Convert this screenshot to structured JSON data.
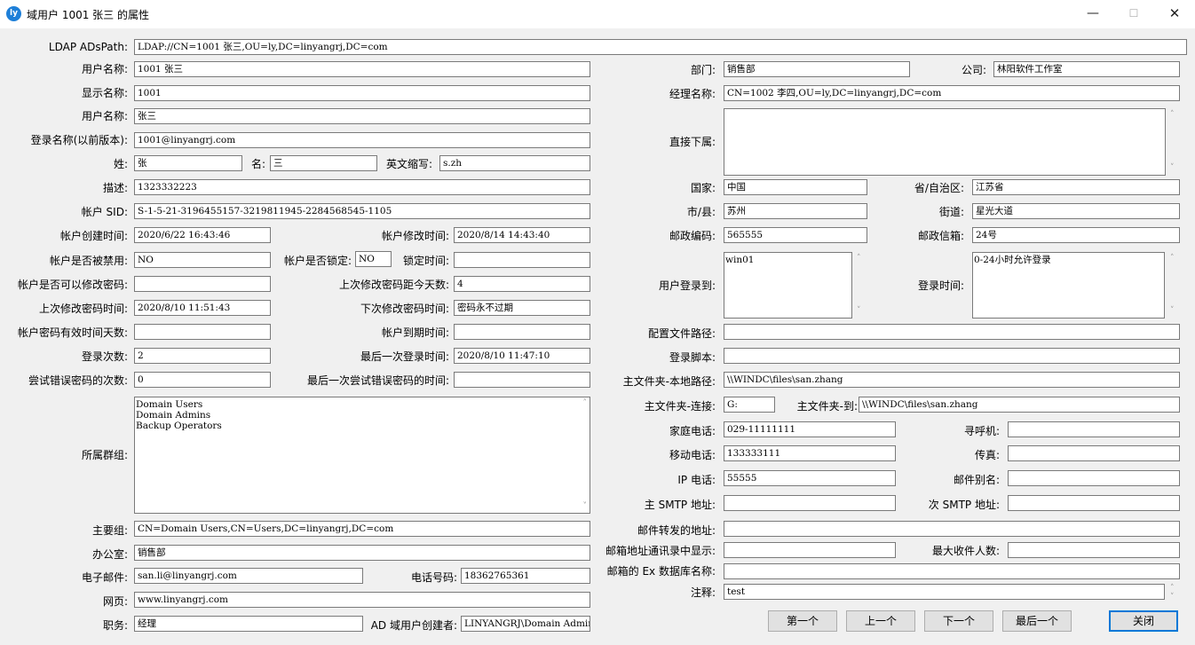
{
  "window": {
    "title": "域用户 1001 张三 的属性",
    "minimize": "—",
    "maximize": "☐",
    "close": "✕"
  },
  "icons": {
    "app": "app-logo-icon",
    "scroll_up": "˄",
    "scroll_down": "˅"
  },
  "ldap": {
    "label": "LDAP ADsPath:",
    "value": "LDAP://CN=1001 张三,OU=ly,DC=linyangrj,DC=com"
  },
  "left": {
    "username": {
      "label": "用户名称:",
      "value": "1001 张三"
    },
    "display_name": {
      "label": "显示名称:",
      "value": "1001"
    },
    "username2": {
      "label": "用户名称:",
      "value": "张三"
    },
    "login_name": {
      "label": "登录名称(以前版本):",
      "value": "1001@linyangrj.com"
    },
    "surname": {
      "label": "姓:",
      "value": "张"
    },
    "given_name": {
      "label": "名:",
      "value": "三"
    },
    "initials": {
      "label": "英文缩写:",
      "value": "s.zh"
    },
    "description": {
      "label": "描述:",
      "value": "1323332223"
    },
    "sid": {
      "label": "帐户 SID:",
      "value": "S-1-5-21-3196455157-3219811945-2284568545-1105"
    },
    "created": {
      "label": "帐户创建时间:",
      "value": "2020/6/22 16:43:46"
    },
    "modified": {
      "label": "帐户修改时间:",
      "value": "2020/8/14 14:43:40"
    },
    "disabled": {
      "label": "帐户是否被禁用:",
      "value": "NO"
    },
    "locked": {
      "label": "帐户是否锁定:",
      "value": "NO"
    },
    "lock_time": {
      "label": "锁定时间:",
      "value": ""
    },
    "can_change_pwd": {
      "label": "帐户是否可以修改密码:",
      "value": ""
    },
    "days_since_pwd": {
      "label": "上次修改密码距今天数:",
      "value": "4"
    },
    "last_pwd_change": {
      "label": "上次修改密码时间:",
      "value": "2020/8/10 11:51:43"
    },
    "next_pwd_change": {
      "label": "下次修改密码时间:",
      "value": "密码永不过期"
    },
    "pwd_valid_days": {
      "label": "帐户密码有效时间天数:",
      "value": ""
    },
    "expiry": {
      "label": "帐户到期时间:",
      "value": ""
    },
    "logon_count": {
      "label": "登录次数:",
      "value": "2"
    },
    "last_logon": {
      "label": "最后一次登录时间:",
      "value": "2020/8/10 11:47:10"
    },
    "bad_pwd_count": {
      "label": "尝试错误密码的次数:",
      "value": "0"
    },
    "last_bad_pwd": {
      "label": "最后一次尝试错误密码的时间:",
      "value": ""
    },
    "groups": {
      "label": "所属群组:",
      "items": [
        "Domain Users",
        "Domain Admins",
        "Backup Operators"
      ]
    },
    "primary_group": {
      "label": "主要组:",
      "value": "CN=Domain Users,CN=Users,DC=linyangrj,DC=com"
    },
    "office": {
      "label": "办公室:",
      "value": "销售部"
    },
    "email": {
      "label": "电子邮件:",
      "value": "san.li@linyangrj.com"
    },
    "phone": {
      "label": "电话号码:",
      "value": "18362765361"
    },
    "webpage": {
      "label": "网页:",
      "value": "www.linyangrj.com"
    },
    "title": {
      "label": "职务:",
      "value": "经理"
    },
    "creator": {
      "label": "AD 域用户创建者:",
      "value": "LINYANGRJ\\Domain Admins"
    }
  },
  "right": {
    "department": {
      "label": "部门:",
      "value": "销售部"
    },
    "company": {
      "label": "公司:",
      "value": "林阳软件工作室"
    },
    "manager": {
      "label": "经理名称:",
      "value": "CN=1002 李四,OU=ly,DC=linyangrj,DC=com"
    },
    "direct_reports": {
      "label": "直接下属:",
      "value": ""
    },
    "country": {
      "label": "国家:",
      "value": "中国"
    },
    "province": {
      "label": "省/自治区:",
      "value": "江苏省"
    },
    "city": {
      "label": "市/县:",
      "value": "苏州"
    },
    "street": {
      "label": "街道:",
      "value": "星光大道"
    },
    "postal_code": {
      "label": "邮政编码:",
      "value": "565555"
    },
    "po_box": {
      "label": "邮政信箱:",
      "value": "24号"
    },
    "logon_to": {
      "label": "用户登录到:",
      "value": "win01"
    },
    "logon_hours": {
      "label": "登录时间:",
      "value": "0-24小时允许登录"
    },
    "profile_path": {
      "label": "配置文件路径:",
      "value": ""
    },
    "logon_script": {
      "label": "登录脚本:",
      "value": ""
    },
    "home_local": {
      "label": "主文件夹-本地路径:",
      "value": "\\\\WINDC\\files\\san.zhang"
    },
    "home_drive": {
      "label": "主文件夹-连接:",
      "value": "G:"
    },
    "home_to": {
      "label": "主文件夹-到:",
      "value": "\\\\WINDC\\files\\san.zhang"
    },
    "home_phone": {
      "label": "家庭电话:",
      "value": "029-11111111"
    },
    "pager": {
      "label": "寻呼机:",
      "value": ""
    },
    "mobile": {
      "label": "移动电话:",
      "value": "133333111"
    },
    "fax": {
      "label": "传真:",
      "value": ""
    },
    "ip_phone": {
      "label": "IP 电话:",
      "value": "55555"
    },
    "mail_alias": {
      "label": "邮件别名:",
      "value": ""
    },
    "smtp_primary": {
      "label": "主 SMTP 地址:",
      "value": ""
    },
    "smtp_secondary": {
      "label": "次 SMTP 地址:",
      "value": ""
    },
    "forward": {
      "label": "邮件转发的地址:",
      "value": ""
    },
    "show_in_gal": {
      "label": "邮箱地址通讯录中显示:",
      "value": ""
    },
    "max_recipients": {
      "label": "最大收件人数:",
      "value": ""
    },
    "ex_database": {
      "label": "邮箱的 Ex 数据库名称:",
      "value": ""
    },
    "notes": {
      "label": "注释:",
      "value": "test"
    }
  },
  "buttons": {
    "first": "第一个",
    "prev": "上一个",
    "next": "下一个",
    "last": "最后一个",
    "close": "关闭"
  }
}
